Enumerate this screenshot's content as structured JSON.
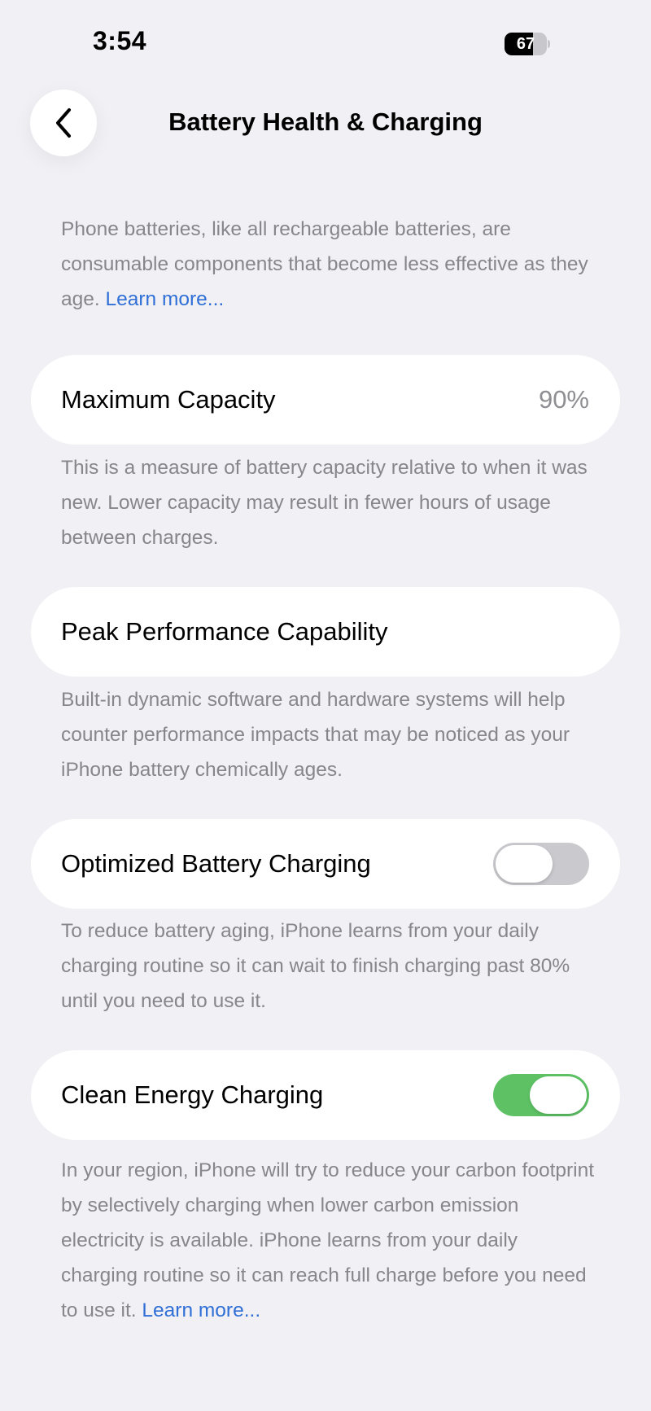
{
  "status_bar": {
    "time": "3:54",
    "battery_level": "67",
    "battery_fraction": 0.67
  },
  "header": {
    "title": "Battery Health & Charging",
    "back_icon": "chevron-left-icon"
  },
  "intro": {
    "text": "Phone batteries, like all rechargeable batteries, are consumable components that become less effective as they age.",
    "link": "Learn more..."
  },
  "maximum_capacity": {
    "label": "Maximum Capacity",
    "value": "90%",
    "description": "This is a measure of battery capacity relative to when it was new. Lower capacity may result in fewer hours of usage between charges."
  },
  "peak_performance": {
    "label": "Peak Performance Capability",
    "description": "Built-in dynamic software and hardware systems will help counter performance impacts that may be noticed as your iPhone battery chemically ages."
  },
  "optimized_charging": {
    "label": "Optimized Battery Charging",
    "enabled": false,
    "description": "To reduce battery aging, iPhone learns from your daily charging routine so it can wait to finish charging past 80% until you need to use it."
  },
  "clean_energy": {
    "label": "Clean Energy Charging",
    "enabled": true,
    "description": "In your region, iPhone will try to reduce your carbon footprint by selectively charging when lower carbon emission electricity is available. iPhone learns from your daily charging routine so it can reach full charge before you need to use it.",
    "link": "Learn more..."
  },
  "colors": {
    "background": "#f0f0f5",
    "toggle_on": "#5ec265",
    "toggle_off": "#c9c9ce",
    "link": "#2f6fd6",
    "secondary_text": "#86868b"
  }
}
